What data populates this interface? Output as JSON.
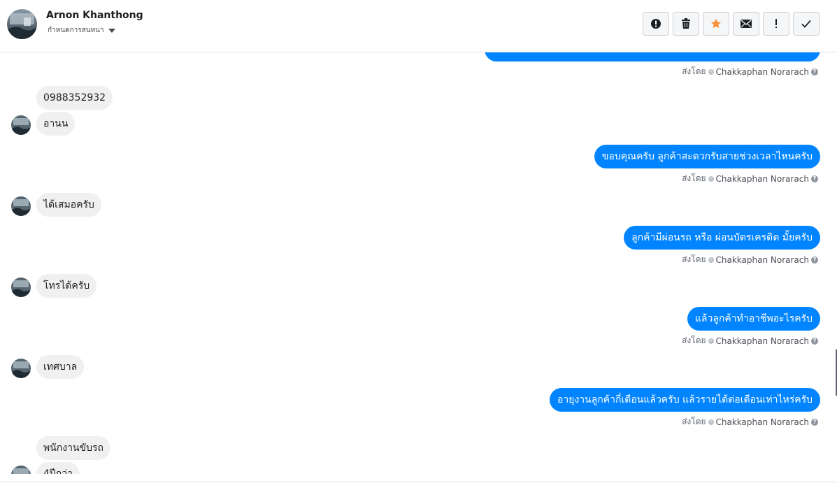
{
  "header": {
    "contact_name": "Arnon Khanthong",
    "label_selector": "กำหนดการสนทนา",
    "toolbar": [
      {
        "icon": "alert-circle-icon",
        "label": "Mark as spam"
      },
      {
        "icon": "trash-icon",
        "label": "Delete"
      },
      {
        "icon": "star-icon",
        "label": "Star",
        "color": "#f7923b"
      },
      {
        "icon": "envelope-icon",
        "label": "Mark as unread"
      },
      {
        "icon": "exclamation-icon",
        "label": "Follow up"
      },
      {
        "icon": "checkmark-icon",
        "label": "Done"
      }
    ]
  },
  "conversation": {
    "sent_by_label": "ส่งโดย",
    "agent_name": "Chakkaphan Norarach",
    "messages": [
      {
        "side": "out",
        "text": ""
      },
      {
        "side": "in",
        "text": "0988352932"
      },
      {
        "side": "in",
        "text": "อานน"
      },
      {
        "side": "out",
        "text": "ขอบคุณครับ ลูกค้าสะดวกรับสายช่วงเวลาไหนครับ"
      },
      {
        "side": "in",
        "text": "ได้เสมอครับ"
      },
      {
        "side": "out",
        "text": "ลูกค้ามีผ่อนรถ หรือ ผ่อนบัตรเครดิต มั้ยครับ"
      },
      {
        "side": "in",
        "text": "โทรได้ครับ"
      },
      {
        "side": "out",
        "text": "แล้วลูกค้าทำอาชีพอะไรครับ"
      },
      {
        "side": "in",
        "text": "เทศบาล"
      },
      {
        "side": "out",
        "text": "อายุงานลูกค้ากี่เดือนแล้วครับ แล้วรายได้ต่อเดือนเท่าไหร่ครับ"
      },
      {
        "side": "in",
        "text": "พนักงานขับรถ"
      },
      {
        "side": "in",
        "text": "4ปีกว่า"
      }
    ]
  },
  "colors": {
    "outgoing_bubble": "#0084ff",
    "incoming_bubble": "#f1f0f0",
    "star_active": "#f7923b"
  }
}
